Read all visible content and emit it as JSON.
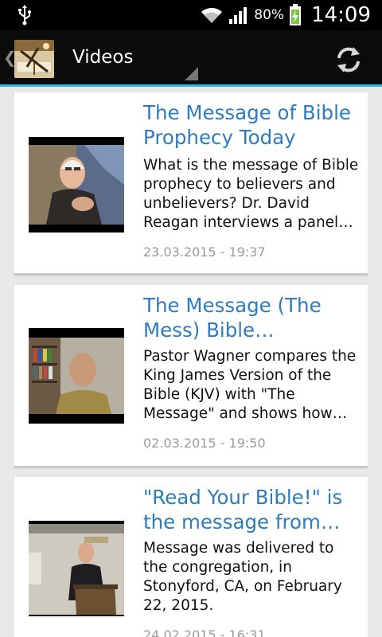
{
  "status_bar": {
    "battery_percent": "80%",
    "time": "14:09",
    "icons": [
      "usb-icon",
      "wifi-icon",
      "signal-icon",
      "battery-charging-icon"
    ]
  },
  "action_bar": {
    "title": "Videos",
    "icons": [
      "up-chevron-icon",
      "app-logo",
      "refresh-icon"
    ],
    "accent_color": "#33b5e5"
  },
  "videos": [
    {
      "title": "The Message of Bible Prophecy Today",
      "description": "What is the message of Bible prophecy to believers and unbelievers? Dr. David Reagan interviews a panel…",
      "date": "23.03.2015 - 19:37"
    },
    {
      "title": "The Message (The Mess) Bible…",
      "description": "Pastor Wagner compares the King James Version of the Bible (KJV) with \"The Message\" and shows how…",
      "date": "02.03.2015 - 19:50"
    },
    {
      "title": "\"Read Your Bible!\" is the message from…",
      "description": "Message was delivered to the congregation, in Stonyford, CA, on February 22, 2015.",
      "date": "24.02.2015 - 16:31"
    }
  ],
  "colors": {
    "title_blue": "#2e7bbf",
    "date_gray": "#9a9a9a",
    "background": "#e8e8e8"
  }
}
